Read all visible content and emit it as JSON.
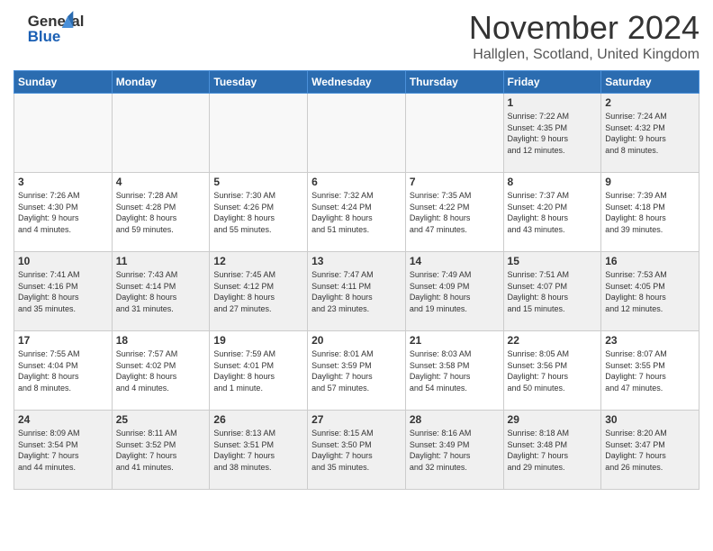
{
  "header": {
    "logo_line1": "General",
    "logo_line2": "Blue",
    "month_title": "November 2024",
    "location": "Hallglen, Scotland, United Kingdom"
  },
  "weekdays": [
    "Sunday",
    "Monday",
    "Tuesday",
    "Wednesday",
    "Thursday",
    "Friday",
    "Saturday"
  ],
  "rows": [
    [
      {
        "day": "",
        "info": "",
        "empty": true
      },
      {
        "day": "",
        "info": "",
        "empty": true
      },
      {
        "day": "",
        "info": "",
        "empty": true
      },
      {
        "day": "",
        "info": "",
        "empty": true
      },
      {
        "day": "",
        "info": "",
        "empty": true
      },
      {
        "day": "1",
        "info": "Sunrise: 7:22 AM\nSunset: 4:35 PM\nDaylight: 9 hours\nand 12 minutes."
      },
      {
        "day": "2",
        "info": "Sunrise: 7:24 AM\nSunset: 4:32 PM\nDaylight: 9 hours\nand 8 minutes."
      }
    ],
    [
      {
        "day": "3",
        "info": "Sunrise: 7:26 AM\nSunset: 4:30 PM\nDaylight: 9 hours\nand 4 minutes."
      },
      {
        "day": "4",
        "info": "Sunrise: 7:28 AM\nSunset: 4:28 PM\nDaylight: 8 hours\nand 59 minutes."
      },
      {
        "day": "5",
        "info": "Sunrise: 7:30 AM\nSunset: 4:26 PM\nDaylight: 8 hours\nand 55 minutes."
      },
      {
        "day": "6",
        "info": "Sunrise: 7:32 AM\nSunset: 4:24 PM\nDaylight: 8 hours\nand 51 minutes."
      },
      {
        "day": "7",
        "info": "Sunrise: 7:35 AM\nSunset: 4:22 PM\nDaylight: 8 hours\nand 47 minutes."
      },
      {
        "day": "8",
        "info": "Sunrise: 7:37 AM\nSunset: 4:20 PM\nDaylight: 8 hours\nand 43 minutes."
      },
      {
        "day": "9",
        "info": "Sunrise: 7:39 AM\nSunset: 4:18 PM\nDaylight: 8 hours\nand 39 minutes."
      }
    ],
    [
      {
        "day": "10",
        "info": "Sunrise: 7:41 AM\nSunset: 4:16 PM\nDaylight: 8 hours\nand 35 minutes."
      },
      {
        "day": "11",
        "info": "Sunrise: 7:43 AM\nSunset: 4:14 PM\nDaylight: 8 hours\nand 31 minutes."
      },
      {
        "day": "12",
        "info": "Sunrise: 7:45 AM\nSunset: 4:12 PM\nDaylight: 8 hours\nand 27 minutes."
      },
      {
        "day": "13",
        "info": "Sunrise: 7:47 AM\nSunset: 4:11 PM\nDaylight: 8 hours\nand 23 minutes."
      },
      {
        "day": "14",
        "info": "Sunrise: 7:49 AM\nSunset: 4:09 PM\nDaylight: 8 hours\nand 19 minutes."
      },
      {
        "day": "15",
        "info": "Sunrise: 7:51 AM\nSunset: 4:07 PM\nDaylight: 8 hours\nand 15 minutes."
      },
      {
        "day": "16",
        "info": "Sunrise: 7:53 AM\nSunset: 4:05 PM\nDaylight: 8 hours\nand 12 minutes."
      }
    ],
    [
      {
        "day": "17",
        "info": "Sunrise: 7:55 AM\nSunset: 4:04 PM\nDaylight: 8 hours\nand 8 minutes."
      },
      {
        "day": "18",
        "info": "Sunrise: 7:57 AM\nSunset: 4:02 PM\nDaylight: 8 hours\nand 4 minutes."
      },
      {
        "day": "19",
        "info": "Sunrise: 7:59 AM\nSunset: 4:01 PM\nDaylight: 8 hours\nand 1 minute."
      },
      {
        "day": "20",
        "info": "Sunrise: 8:01 AM\nSunset: 3:59 PM\nDaylight: 7 hours\nand 57 minutes."
      },
      {
        "day": "21",
        "info": "Sunrise: 8:03 AM\nSunset: 3:58 PM\nDaylight: 7 hours\nand 54 minutes."
      },
      {
        "day": "22",
        "info": "Sunrise: 8:05 AM\nSunset: 3:56 PM\nDaylight: 7 hours\nand 50 minutes."
      },
      {
        "day": "23",
        "info": "Sunrise: 8:07 AM\nSunset: 3:55 PM\nDaylight: 7 hours\nand 47 minutes."
      }
    ],
    [
      {
        "day": "24",
        "info": "Sunrise: 8:09 AM\nSunset: 3:54 PM\nDaylight: 7 hours\nand 44 minutes."
      },
      {
        "day": "25",
        "info": "Sunrise: 8:11 AM\nSunset: 3:52 PM\nDaylight: 7 hours\nand 41 minutes."
      },
      {
        "day": "26",
        "info": "Sunrise: 8:13 AM\nSunset: 3:51 PM\nDaylight: 7 hours\nand 38 minutes."
      },
      {
        "day": "27",
        "info": "Sunrise: 8:15 AM\nSunset: 3:50 PM\nDaylight: 7 hours\nand 35 minutes."
      },
      {
        "day": "28",
        "info": "Sunrise: 8:16 AM\nSunset: 3:49 PM\nDaylight: 7 hours\nand 32 minutes."
      },
      {
        "day": "29",
        "info": "Sunrise: 8:18 AM\nSunset: 3:48 PM\nDaylight: 7 hours\nand 29 minutes."
      },
      {
        "day": "30",
        "info": "Sunrise: 8:20 AM\nSunset: 3:47 PM\nDaylight: 7 hours\nand 26 minutes."
      }
    ]
  ]
}
